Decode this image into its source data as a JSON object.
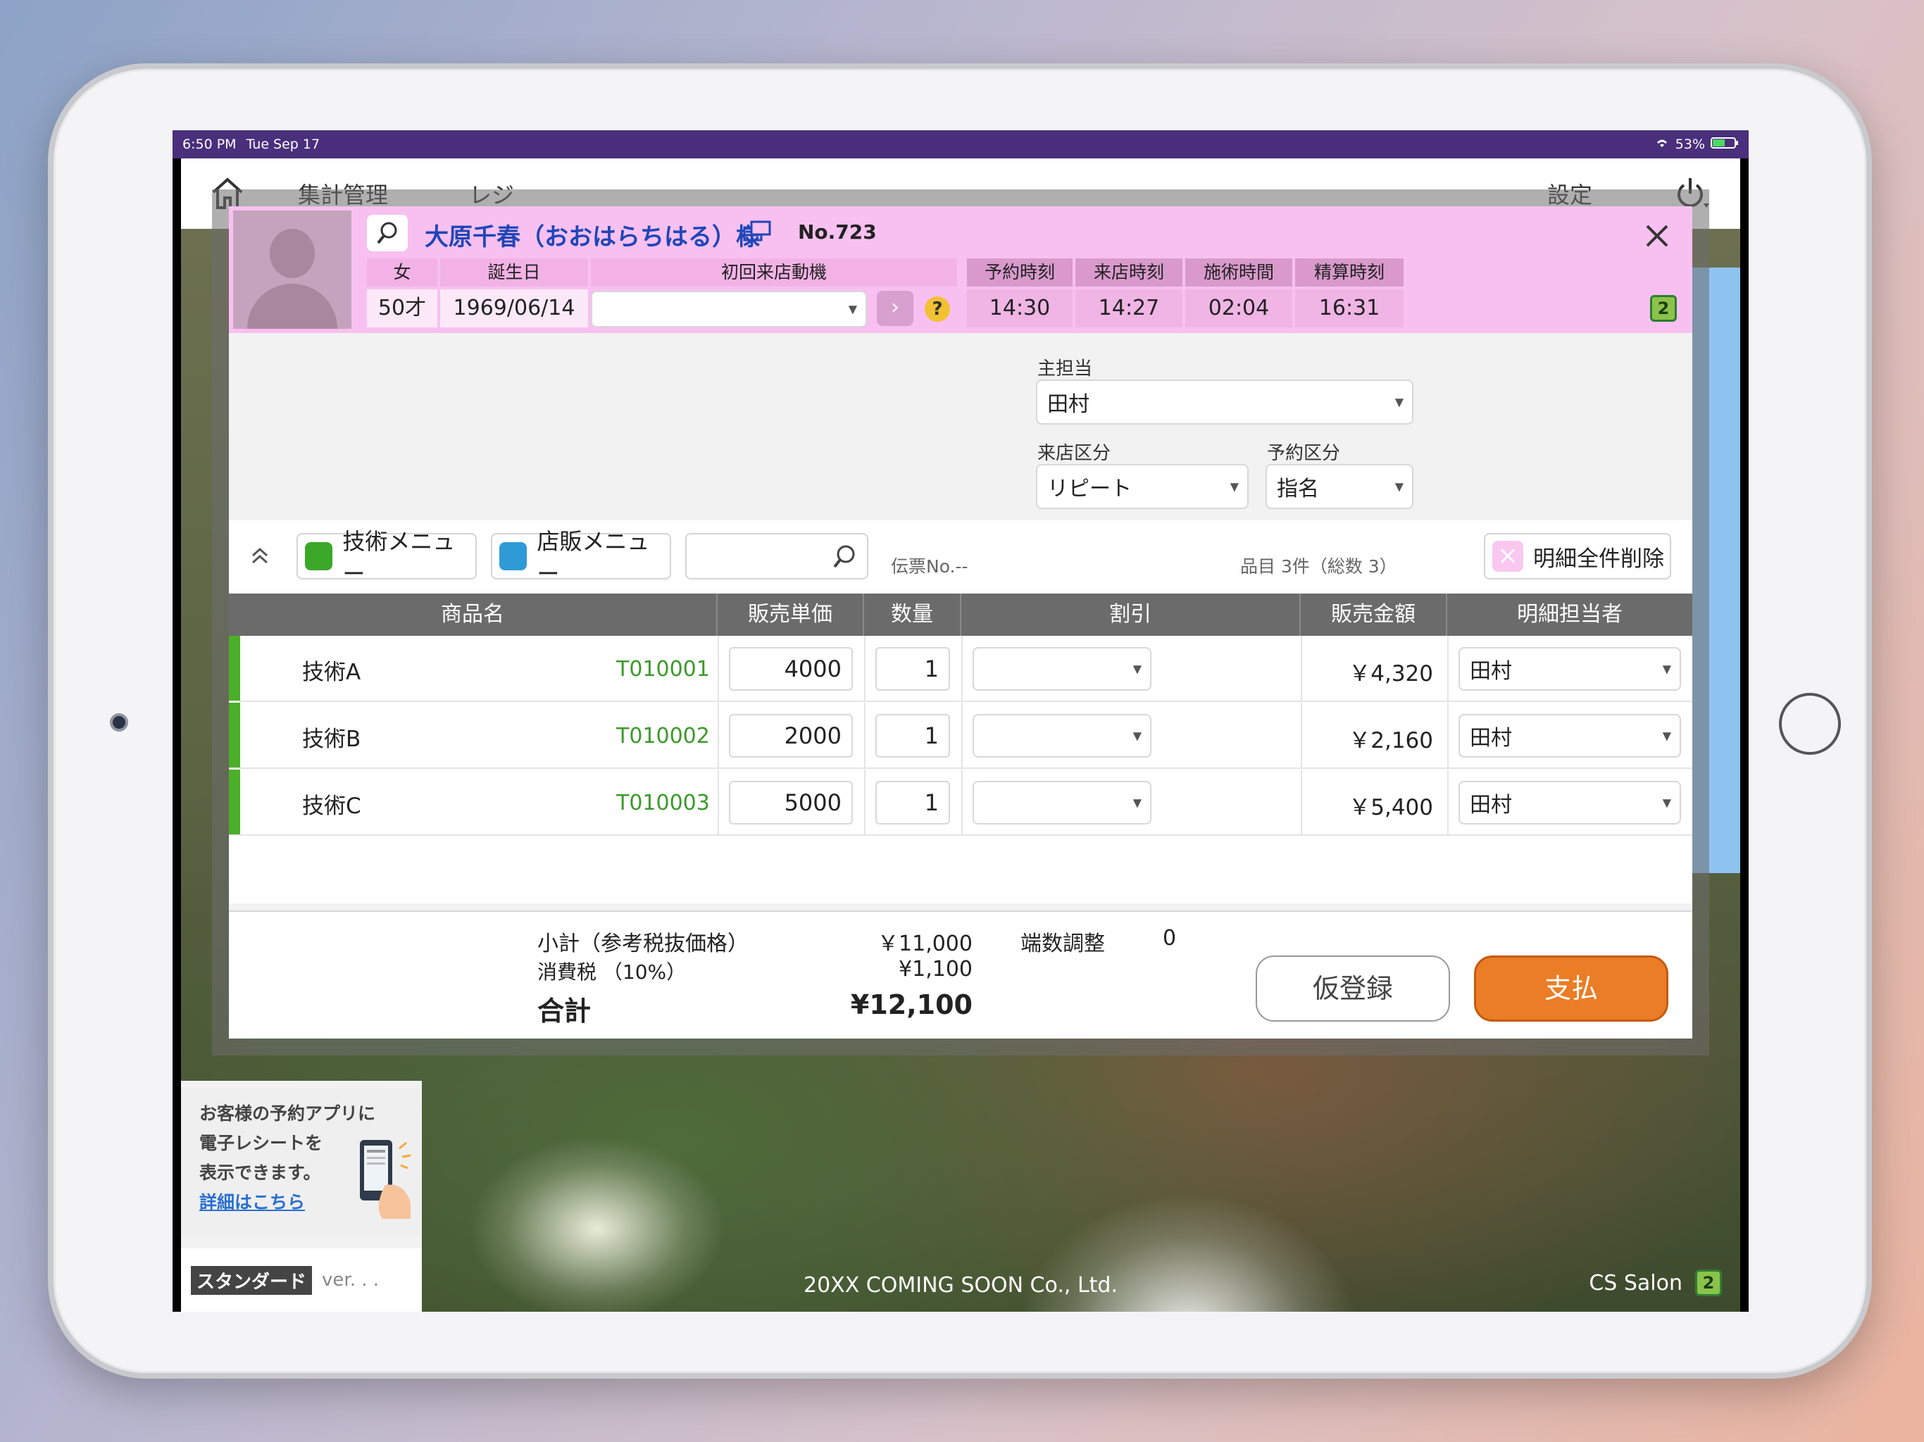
{
  "status": {
    "time": "6:50 PM",
    "date": "Tue Sep 17",
    "battery": "53%"
  },
  "appbar": {
    "nav1": "集計管理",
    "nav2": "レジ",
    "settings": "設定"
  },
  "customer": {
    "name": "大原千春（おおはらちはる）様",
    "number": "No.723",
    "gender_label": "女",
    "age": "50才",
    "birthday_label": "誕生日",
    "birthday": "1969/06/14",
    "motive_label": "初回来店動機",
    "motive_value": "",
    "help": "?",
    "badge": "2"
  },
  "times": [
    {
      "label": "予約時刻",
      "value": "14:30"
    },
    {
      "label": "来店時刻",
      "value": "14:27"
    },
    {
      "label": "施術時間",
      "value": "02:04"
    },
    {
      "label": "精算時刻",
      "value": "16:31"
    }
  ],
  "form": {
    "main_staff_label": "主担当",
    "main_staff": "田村",
    "visit_type_label": "来店区分",
    "visit_type": "リピート",
    "reserve_type_label": "予約区分",
    "reserve_type": "指名"
  },
  "toolbar": {
    "tech_menu": "技術メニュー",
    "retail_menu": "店販メニュー",
    "search_value": "",
    "slip_no": "伝票No.--",
    "item_count": "品目 3件（総数 3）",
    "delete_all": "明細全件削除"
  },
  "table": {
    "headers": [
      "商品名",
      "販売単価",
      "数量",
      "割引",
      "販売金額",
      "明細担当者"
    ],
    "rows": [
      {
        "name": "技術A",
        "code": "T010001",
        "price": "4000",
        "qty": "1",
        "discount": "",
        "amount": "￥4,320",
        "staff": "田村"
      },
      {
        "name": "技術B",
        "code": "T010002",
        "price": "2000",
        "qty": "1",
        "discount": "",
        "amount": "￥2,160",
        "staff": "田村"
      },
      {
        "name": "技術C",
        "code": "T010003",
        "price": "5000",
        "qty": "1",
        "discount": "",
        "amount": "￥5,400",
        "staff": "田村"
      }
    ]
  },
  "totals": {
    "subtotal_label": "小計（参考税抜価格）",
    "subtotal": "￥11,000",
    "tax_label": "消費税 （10%）",
    "tax": "¥1,100",
    "total_label": "合計",
    "total": "¥12,100",
    "rounding_label": "端数調整",
    "rounding": "0"
  },
  "actions": {
    "temp_save": "仮登録",
    "pay": "支払"
  },
  "promo": {
    "line1": "お客様の予約アプリに",
    "line2": "電子レシートを",
    "line3": "表示できます。",
    "link": "詳細はこちら"
  },
  "footer": {
    "edition": "スタンダード",
    "version": "ver. . .",
    "company": "20XX COMING SOON Co., Ltd.",
    "salon": "CS Salon",
    "badge": "2"
  },
  "colors": {
    "accent_pay": "#ea7d26",
    "header_pink": "#f8c0f0",
    "status_purple": "#4a2f7c",
    "row_green": "#4caf2a"
  }
}
